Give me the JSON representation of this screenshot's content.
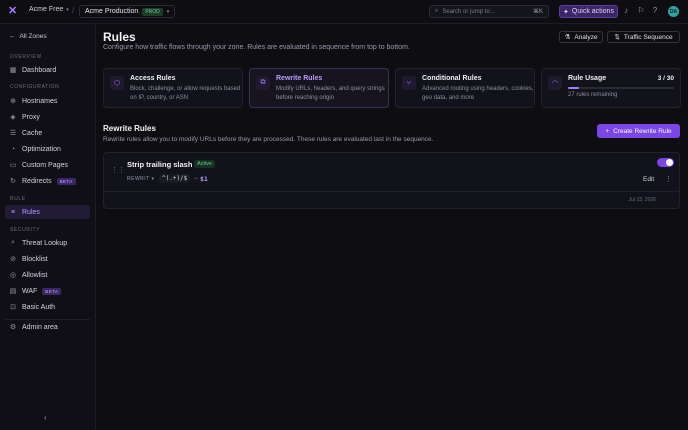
{
  "topbar": {
    "org_name": "Acme Free",
    "project_name": "Acme Production",
    "project_badge": "PROD",
    "search_placeholder": "Search or jump to...",
    "search_shortcut": "⌘K",
    "quick_actions_label": "Quick actions",
    "avatar_initials": "DA"
  },
  "sidebar": {
    "back_label": "All Zones",
    "sections": {
      "overview": "OVERVIEW",
      "configuration": "CONFIGURATION",
      "rule": "RULE",
      "security": "SECURITY"
    },
    "items": {
      "dashboard": "Dashboard",
      "hostnames": "Hostnames",
      "proxy": "Proxy",
      "cache": "Cache",
      "optimization": "Optimization",
      "custom_pages": "Custom Pages",
      "redirects": "Redirects",
      "rules": "Rules",
      "threat_lookup": "Threat Lookup",
      "blocklist": "Blocklist",
      "allowlist": "Allowlist",
      "waf": "WAF",
      "basic_auth": "Basic Auth",
      "admin_area": "Admin area"
    },
    "beta_label": "BETA"
  },
  "header": {
    "title": "Rules",
    "subtitle": "Configure how traffic flows through your zone. Rules are evaluated in sequence from top to bottom.",
    "analyze_label": "Analyze",
    "traffic_sequence_label": "Traffic Sequence"
  },
  "cards": {
    "access": {
      "title": "Access Rules",
      "desc": "Block, challenge, or allow requests based on IP, country, or ASN"
    },
    "rewrite": {
      "title": "Rewrite Rules",
      "desc": "Modify URLs, headers, and query strings before reaching origin"
    },
    "conditional": {
      "title": "Conditional Rules",
      "desc": "Advanced routing using headers, cookies, geo data, and more"
    },
    "usage": {
      "title": "Rule Usage",
      "count": "3 / 30",
      "used": 3,
      "limit": 30,
      "remaining": "27 rules remaining"
    }
  },
  "rewrite_section": {
    "title": "Rewrite Rules",
    "subtitle": "Rewrite rules allow you to modify URLs before they are processed. These rules are evaluated last in the sequence.",
    "create_label": "Create Rewrite Rule"
  },
  "rule": {
    "name": "Strip trailing slash",
    "status": "Active",
    "type": "REWRIT",
    "pattern": "^(.+)/$",
    "arrow": "→",
    "replacement": "$1",
    "edit_label": "Edit",
    "date": "Jul 23, 2026",
    "enabled": true
  },
  "colors": {
    "accent": "#7b45e8",
    "accent_light": "#b99aff",
    "success": "#5fd08e",
    "background": "#0d0d12"
  }
}
